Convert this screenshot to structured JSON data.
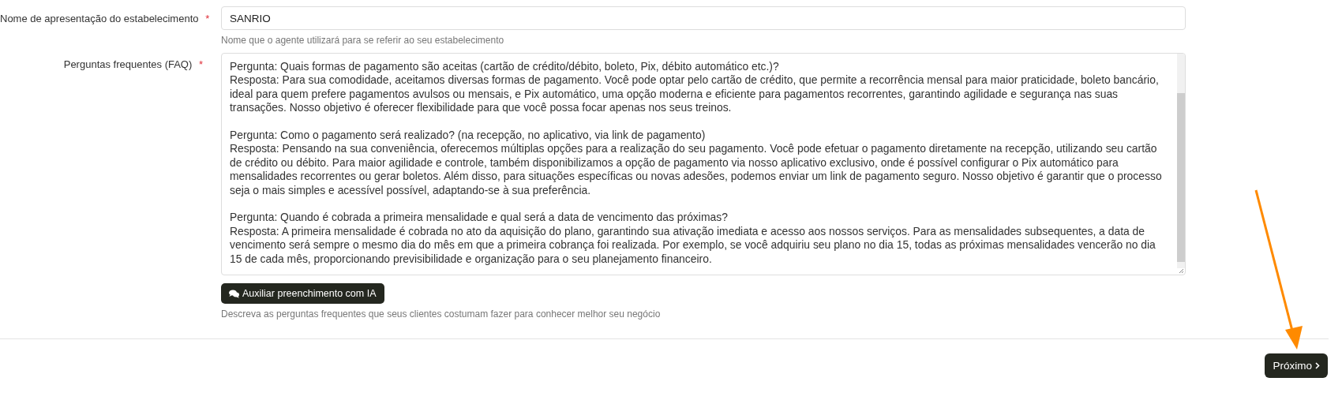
{
  "fields": [
    {
      "kind": "input",
      "label": "Nome de apresentação do estabelecimento",
      "required_mark": "*",
      "value": "SANRIO",
      "help": "Nome que o agente utilizará para se referir ao seu estabelecimento"
    },
    {
      "kind": "textarea",
      "label": "Perguntas frequentes (FAQ)",
      "required_mark": "*",
      "value": "Pergunta: Quais formas de pagamento são aceitas (cartão de crédito/débito, boleto, Pix, débito automático etc.)?\nResposta: Para sua comodidade, aceitamos diversas formas de pagamento. Você pode optar pelo cartão de crédito, que permite a recorrência mensal para maior praticidade, boleto bancário, ideal para quem prefere pagamentos avulsos ou mensais, e Pix automático, uma opção moderna e eficiente para pagamentos recorrentes, garantindo agilidade e segurança nas suas transações. Nosso objetivo é oferecer flexibilidade para que você possa focar apenas nos seus treinos.\n\nPergunta: Como o pagamento será realizado? (na recepção, no aplicativo, via link de pagamento)\nResposta: Pensando na sua conveniência, oferecemos múltiplas opções para a realização do seu pagamento. Você pode efetuar o pagamento diretamente na recepção, utilizando seu cartão de crédito ou débito. Para maior agilidade e controle, também disponibilizamos a opção de pagamento via nosso aplicativo exclusivo, onde é possível configurar o Pix automático para mensalidades recorrentes ou gerar boletos. Além disso, para situações específicas ou novas adesões, podemos enviar um link de pagamento seguro. Nosso objetivo é garantir que o processo seja o mais simples e acessível possível, adaptando-se à sua preferência.\n\nPergunta: Quando é cobrada a primeira mensalidade e qual será a data de vencimento das próximas?\nResposta: A primeira mensalidade é cobrada no ato da aquisição do plano, garantindo sua ativação imediata e acesso aos nossos serviços. Para as mensalidades subsequentes, a data de vencimento será sempre o mesmo dia do mês em que a primeira cobrança foi realizada. Por exemplo, se você adquiriu seu plano no dia 15, todas as próximas mensalidades vencerão no dia 15 de cada mês, proporcionando previsibilidade e organização para o seu planejamento financeiro.",
      "assist_button": "Auxiliar preenchimento com IA",
      "help": "Descreva as perguntas frequentes que seus clientes costumam fazer para conhecer melhor seu negócio"
    }
  ],
  "next_button": "Próximo"
}
